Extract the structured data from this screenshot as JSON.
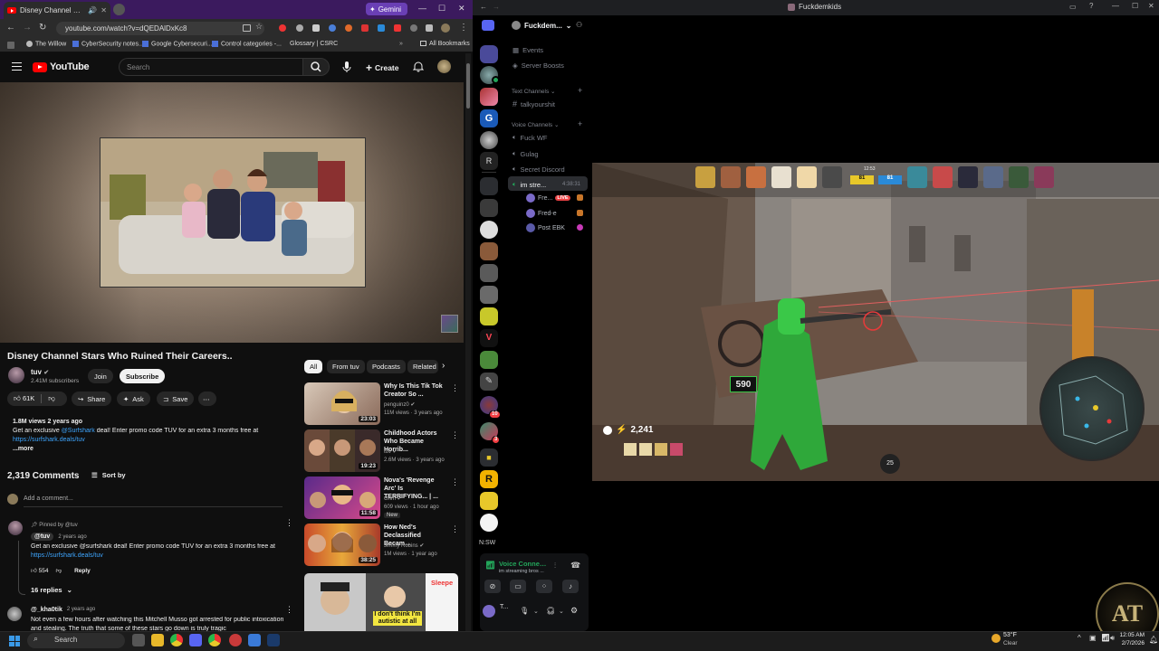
{
  "browser": {
    "tab_title": "Disney Channel Stars Who",
    "gemini_label": "Gemini",
    "url": "youtube.com/watch?v=dQEDAlDxKc8",
    "bookmarks": [
      "The Willow",
      "CyberSecurity notes...",
      "Google Cybersecuri...",
      "Control categories -...",
      "Glossary | CSRC"
    ],
    "all_bookmarks": "All Bookmarks"
  },
  "youtube": {
    "logo": "YouTube",
    "search_placeholder": "Search",
    "create_label": "Create",
    "video_title": "Disney Channel Stars Who Ruined Their Careers..",
    "channel_name": "tuv",
    "subscribers": "2.41M subscribers",
    "join_label": "Join",
    "subscribe_label": "Subscribe",
    "likes": "61K",
    "share_label": "Share",
    "ask_label": "Ask",
    "save_label": "Save",
    "views_line": "1.8M views  2 years ago",
    "desc_line1_prefix": "Get an exclusive ",
    "desc_line1_link": "@Surfshark",
    "desc_line1_suffix": " deal! Enter promo code TUV for an extra 3 months free at",
    "desc_link": "https://surfshark.deals/tuv",
    "more": "...more",
    "comments_count": "2,319 Comments",
    "sort_by": "Sort by",
    "add_comment": "Add a comment...",
    "pinned_by": "Pinned by @tuv",
    "comment1_author": "@tuv",
    "comment1_time": "2 years ago",
    "comment1_text": "Get an exclusive @surfshark deal! Enter promo code TUV for an extra 3 months free at",
    "comment1_link": "https://surfshark.deals/tuv",
    "comment1_likes": "554",
    "reply_label": "Reply",
    "replies": "16 replies",
    "comment2_author": "@_kha0tik",
    "comment2_time": "2 years ago",
    "comment2_text": "Not even a few hours after watching this Mitchell Musso got arrested for public intoxication",
    "comment2_text2": "and stealing. The truth that some of these stars go down is truly tragic",
    "chips": [
      "All",
      "From tuv",
      "Podcasts",
      "Related"
    ],
    "recs": [
      {
        "title": "Why Is This Tik Tok Creator So ...",
        "channel": "penguinz0",
        "meta": "11M views · 3 years ago",
        "duration": "23:03"
      },
      {
        "title": "Childhood Actors Who Became Horrib...",
        "channel": "tuv",
        "meta": "2.6M views · 3 years ago",
        "duration": "19:23"
      },
      {
        "title": "Nova's 'Revenge Arc' Is TERRIFYING... | ...",
        "channel": "Grim",
        "meta": "609 views · 1 hour ago",
        "badge": "New",
        "duration": "11:58"
      },
      {
        "title": "How Ned's Declassified Becam...",
        "channel": "Jimmy Robins",
        "meta": "1M views · 1 year ago",
        "duration": "38:25"
      }
    ],
    "rec5_caption": "I don't think I'm autistic at all",
    "rec5_side": "Sleepe"
  },
  "discord": {
    "window_title": "Fuckdemkids",
    "server_name": "Fuckdem...",
    "events": "Events",
    "server_boosts": "Server Boosts",
    "text_channels_cat": "Text Channels",
    "text_channel": "talkyourshit",
    "voice_channels_cat": "Voice Channels",
    "voice_channels": [
      "Fuck WF",
      "Gulag",
      "Secret Discord"
    ],
    "active_channel": "im stre...",
    "active_timer": "4:38:31",
    "users": [
      {
        "name": "Fre...",
        "live": "LIVE"
      },
      {
        "name": "Fred-e"
      },
      {
        "name": "Post EBK"
      }
    ],
    "server_r_label": "R",
    "server_nsw_label": "N:SW",
    "badge_10": "10",
    "badge_3": "3",
    "voice_connected": "Voice Connected",
    "voice_sub": "im streaming bros ...",
    "user_short": "T..."
  },
  "game_hud": {
    "hp": "2,241",
    "ammo": "590",
    "timer": "12:53",
    "score_left": "81",
    "score_right": "81",
    "ability_25": "25"
  },
  "taskbar": {
    "search": "Search",
    "weather_temp": "53°F",
    "weather_cond": "Clear",
    "time": "12:05 AM",
    "date": "2/7/2026"
  },
  "colors": {
    "youtube_red": "#ff0000",
    "chrome_tab_purple": "#3b1a5e",
    "discord_green": "#23a55a",
    "live_red": "#ed4245",
    "link_blue": "#3ea6ff"
  }
}
